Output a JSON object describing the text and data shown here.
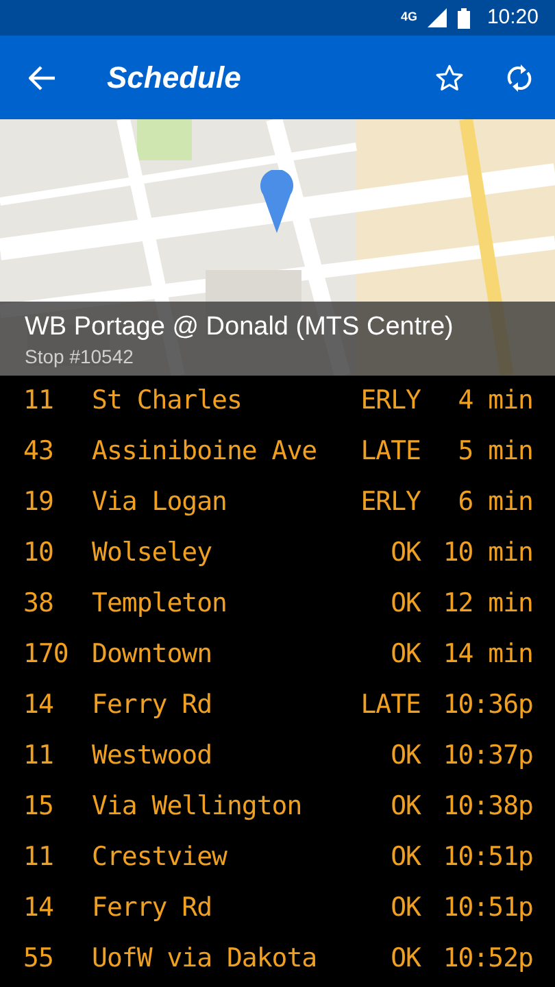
{
  "status_bar": {
    "network": "4G",
    "time": "10:20"
  },
  "toolbar": {
    "title": "Schedule"
  },
  "stop": {
    "name": "WB Portage @ Donald (MTS Centre)",
    "number": "Stop #10542"
  },
  "departures": [
    {
      "route": "11",
      "destination": "St Charles",
      "status": "ERLY",
      "time": "4 min"
    },
    {
      "route": "43",
      "destination": "Assiniboine Ave",
      "status": "LATE",
      "time": "5 min"
    },
    {
      "route": "19",
      "destination": "Via Logan",
      "status": "ERLY",
      "time": "6 min"
    },
    {
      "route": "10",
      "destination": "Wolseley",
      "status": "OK",
      "time": "10 min"
    },
    {
      "route": "38",
      "destination": "Templeton",
      "status": "OK",
      "time": "12 min"
    },
    {
      "route": "170",
      "destination": "Downtown",
      "status": "OK",
      "time": "14 min"
    },
    {
      "route": "14",
      "destination": "Ferry Rd",
      "status": "LATE",
      "time": "10:36p"
    },
    {
      "route": "11",
      "destination": "Westwood",
      "status": "OK",
      "time": "10:37p"
    },
    {
      "route": "15",
      "destination": "Via Wellington",
      "status": "OK",
      "time": "10:38p"
    },
    {
      "route": "11",
      "destination": "Crestview",
      "status": "OK",
      "time": "10:51p"
    },
    {
      "route": "14",
      "destination": "Ferry Rd",
      "status": "OK",
      "time": "10:51p"
    },
    {
      "route": "55",
      "destination": "UofW via Dakota",
      "status": "OK",
      "time": "10:52p"
    }
  ]
}
